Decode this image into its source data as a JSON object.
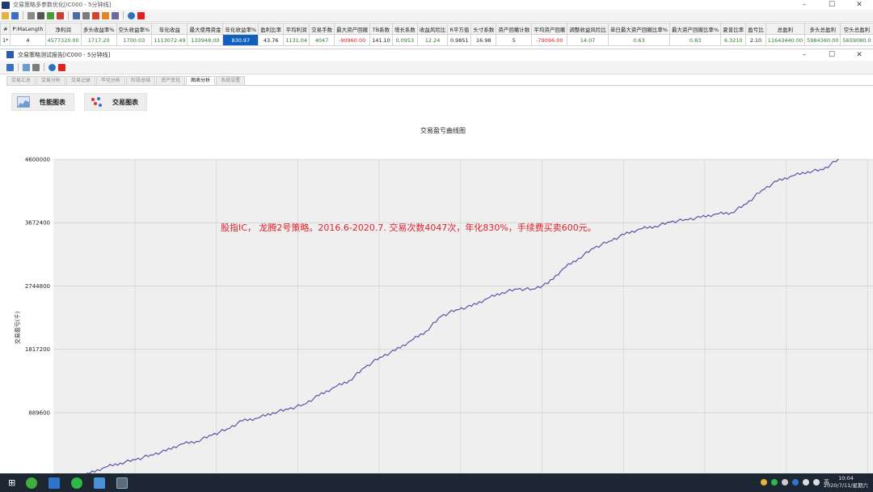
{
  "outer_window": {
    "title": "交易策略多参数优化[IC000 - 5分钟线]",
    "controls": [
      "–",
      "☐",
      "✕"
    ]
  },
  "summary_table": {
    "headers": [
      "#",
      "P:MaLength",
      "净利润",
      "多头收益率%",
      "空头收益率%",
      "年化收益",
      "最大使用资金",
      "年化收益率%",
      "盈利比率",
      "平均利润",
      "交易手数",
      "最大资产回撤",
      "TB系数",
      "增长系数",
      "收益风险比",
      "R平方值",
      "头寸系数",
      "资产回撤计数",
      "平均资产回撤",
      "调整收益风险比",
      "单日最大资产回撤比率%",
      "最大资产回撤比率%",
      "夏普比率",
      "盈亏比",
      "总盈利",
      "多头总盈利",
      "空头总盈利"
    ],
    "row": [
      "1*",
      "4",
      "4577320.00",
      "1717.20",
      "1700.03",
      "1113072.49",
      "133948.00",
      "830.97",
      "43.76",
      "1131.04",
      "4047",
      "-90960.00",
      "141.10",
      "0.0953",
      "12.24",
      "0.9851",
      "16.98",
      "5",
      "-79096.00",
      "14.07",
      "0.63",
      "0.83",
      "6.3210",
      "2.10",
      "11643440.00",
      "5984360.00",
      "5659080.0"
    ]
  },
  "inner_window": {
    "title": "交易策略测试报告[IC000 - 5分钟线]",
    "controls": [
      "–",
      "☐",
      "✕"
    ]
  },
  "tabs": [
    "交易汇总",
    "交易分析",
    "交易记录",
    "年化分析",
    "阶段总结",
    "资产变化",
    "图表分析",
    "系统设置"
  ],
  "active_tab": "图表分析",
  "chart_buttons": {
    "performance": "性能图表",
    "trades": "交易图表"
  },
  "chart_data": {
    "type": "line",
    "title": "交易盈亏曲线图",
    "ylabel": "交易盈亏(千)",
    "xlabel": "",
    "ylim": [
      0,
      4600000
    ],
    "yticks": [
      "4600000",
      "3672400",
      "2744800",
      "1817200",
      "889600"
    ],
    "annotation": "股指IC， 龙腾2号策略。2016.6-2020.7. 交易次数4047次，年化830%，手续费买卖600元。",
    "series": [
      {
        "color": "#5a55a8",
        "x": [
          0,
          2,
          4,
          6,
          8,
          10,
          12,
          14,
          16,
          18,
          20,
          22,
          24,
          26,
          28,
          30,
          32,
          34,
          36,
          38,
          40,
          42,
          44,
          46,
          48,
          50,
          52,
          54,
          56,
          58,
          60,
          62,
          64,
          66,
          68,
          70,
          72,
          74,
          76,
          78,
          80,
          82,
          84,
          86,
          88,
          90,
          92,
          94,
          96,
          98,
          100
        ],
        "y": [
          -100000,
          0,
          90000,
          150000,
          200000,
          270000,
          330000,
          430000,
          470000,
          560000,
          650000,
          770000,
          810000,
          890000,
          940000,
          1010000,
          1140000,
          1260000,
          1360000,
          1550000,
          1700000,
          1800000,
          1940000,
          2080000,
          2300000,
          2400000,
          2450000,
          2560000,
          2650000,
          2700000,
          2700000,
          2780000,
          3000000,
          3150000,
          3300000,
          3400000,
          3500000,
          3580000,
          3620000,
          3680000,
          3720000,
          3750000,
          3800000,
          3820000,
          3950000,
          4150000,
          4280000,
          4360000,
          4420000,
          4450000,
          4600000
        ]
      }
    ]
  },
  "taskbar": {
    "time": "10:04",
    "date": "2020/7/11/星期六",
    "ime": "英"
  },
  "colors": {
    "line": "#5a55a8",
    "annotation": "#e0202a",
    "plot_bg": "#efefef",
    "selected_cell": "#1060c0",
    "positive_value": "#2b7a2b",
    "negative_value": "#dd2222",
    "taskbar": "#1c2733"
  }
}
